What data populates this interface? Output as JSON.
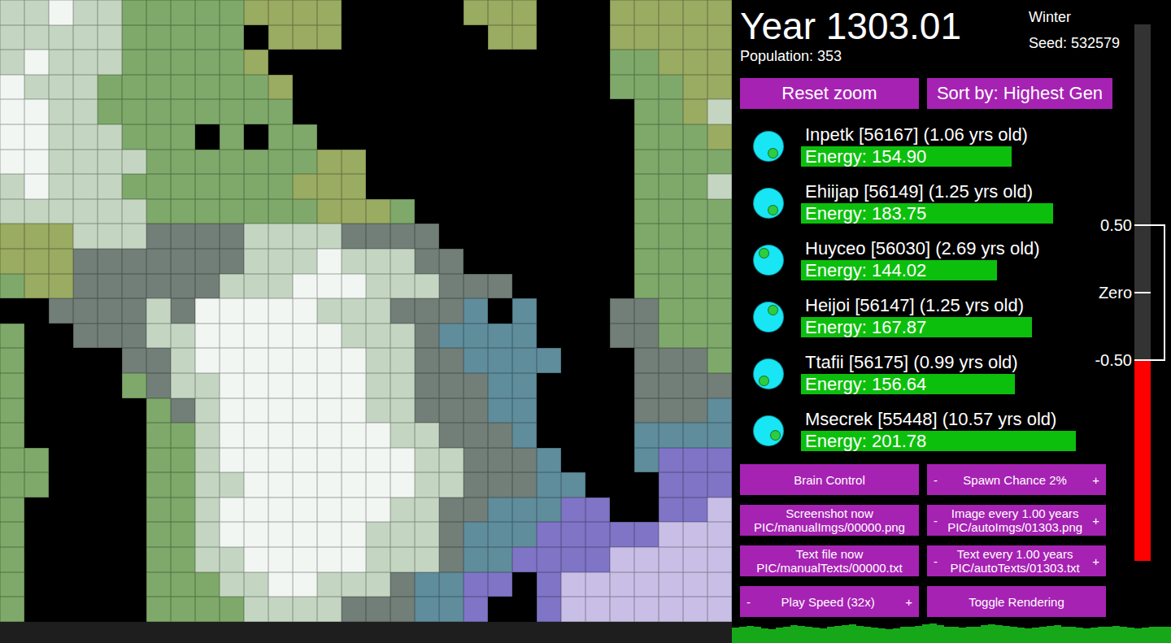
{
  "header": {
    "year": "Year 1303.01",
    "season": "Winter",
    "seed": "Seed: 532579",
    "population": "Population: 353"
  },
  "top_buttons": [
    "Reset zoom",
    "Sort by: Highest Gen"
  ],
  "creatures": [
    {
      "name": "Inpetk [56167] (1.06 yrs old)",
      "energy": "Energy: 154.90",
      "level": 0.72,
      "mouth_angle": 60
    },
    {
      "name": "Ehiijap [56149] (1.25 yrs old)",
      "energy": "Energy: 183.75",
      "level": 0.86,
      "mouth_angle": 55
    },
    {
      "name": "Huyceo [56030] (2.69 yrs old)",
      "energy": "Energy: 144.02",
      "level": 0.67,
      "mouth_angle": -125
    },
    {
      "name": "Heijoi [56147] (1.25 yrs old)",
      "energy": "Energy: 167.87",
      "level": 0.79,
      "mouth_angle": -55
    },
    {
      "name": "Ttafii [56175] (0.99 yrs old)",
      "energy": "Energy: 156.64",
      "level": 0.73,
      "mouth_angle": 125
    },
    {
      "name": "Msecrek [55448] (10.57 yrs old)",
      "energy": "Energy: 201.78",
      "level": 0.94,
      "mouth_angle": 35
    }
  ],
  "controls": [
    {
      "kind": "button",
      "label": "Brain Control"
    },
    {
      "kind": "stepper",
      "minus": "-",
      "label": "Spawn Chance 2%",
      "plus": "+"
    },
    {
      "kind": "button",
      "label": "Screenshot now",
      "path": "PIC/manualImgs/00000.png"
    },
    {
      "kind": "stepper",
      "minus": "-",
      "label": "Image every 1.00 years",
      "plus": "+",
      "path": "PIC/autoImgs/01303.png"
    },
    {
      "kind": "button",
      "label": "Text file now",
      "path": "PIC/manualTexts/00000.txt"
    },
    {
      "kind": "stepper",
      "minus": "-",
      "label": "Text every 1.00 years",
      "plus": "+",
      "path": "PIC/autoTexts/01303.txt"
    },
    {
      "kind": "stepper",
      "minus": "-",
      "label": "Play Speed (32x)",
      "plus": "+"
    },
    {
      "kind": "button",
      "label": "Toggle Rendering"
    }
  ],
  "meter": {
    "labels": [
      "0.50",
      "Zero",
      "-0.50"
    ],
    "level": 0.374
  },
  "population_graph": {
    "values": [
      352,
      354,
      355,
      353,
      351,
      350,
      352,
      354,
      356,
      355,
      353,
      352,
      351,
      353,
      355,
      356,
      357,
      355,
      354,
      352,
      351,
      350,
      351,
      353,
      354,
      355,
      357,
      358,
      356,
      354,
      353,
      352,
      353,
      354,
      356,
      357,
      356,
      355,
      353,
      352,
      351,
      352,
      354,
      355,
      356,
      354,
      353,
      352,
      351,
      352,
      353,
      354,
      355,
      353,
      352,
      351,
      352,
      353,
      354,
      353
    ]
  },
  "map": {
    "palette": {
      ".": "#000000",
      "w": "#f2f6f3",
      "l": "#c4d6c2",
      "g": "#7ea96a",
      "o": "#9aab62",
      "d": "#727e78",
      "b": "#5f8d9c",
      "p": "#7f74c6",
      "v": "#c9bfe6"
    },
    "rows": [
      "llwllgggggoooo.....ooo...ooooo",
      "lllllggggg.ooo......oo...ooooo",
      "lwlllgggggo..............ggooo",
      "wlllgggggggo.............gggoo",
      "wwllgggggggg..............ggol",
      "wwlllggg.g.gg.............gggo",
      "wwllllgggggggoo...........gggg",
      "lwlllgggggggooo...........gggl",
      "llllllgggggggooog.........gggg",
      "ooolllddddlllldddd........gggg",
      "ooodddddddlllwllldd.......gggg",
      "gooddddddlllwwwlllddd.....gggg",
      "..ddddldwwwwwllldddb.b...ddggg",
      "g..dddllwwwwwwllldbbbb...ddggg",
      "g....ddlwwwwwwwllddbbbb...dddg",
      "g....gdllwwwwwwlldddbb....dddd",
      "g.....gdlwwwwwwlldddbb....dddb",
      "g.....gglwwwwwwwlldddb....bbbb",
      "gg....gglwwwwwwwwlldddb...bppp",
      "gg....ggllwwwwwwwlldddbb...ppp",
      "g.....gglwwwwwwwllddbbbpp..ppv",
      "g.....gglwwwwwwllldbbbpppppvvv",
      "g.....ggllwwwwwllldbbppppvvvvv",
      "g.....gggllwwllldbbpp.pvvvvvvv",
      "g.....gggglllldddbbp..pvvvvvvv"
    ]
  }
}
